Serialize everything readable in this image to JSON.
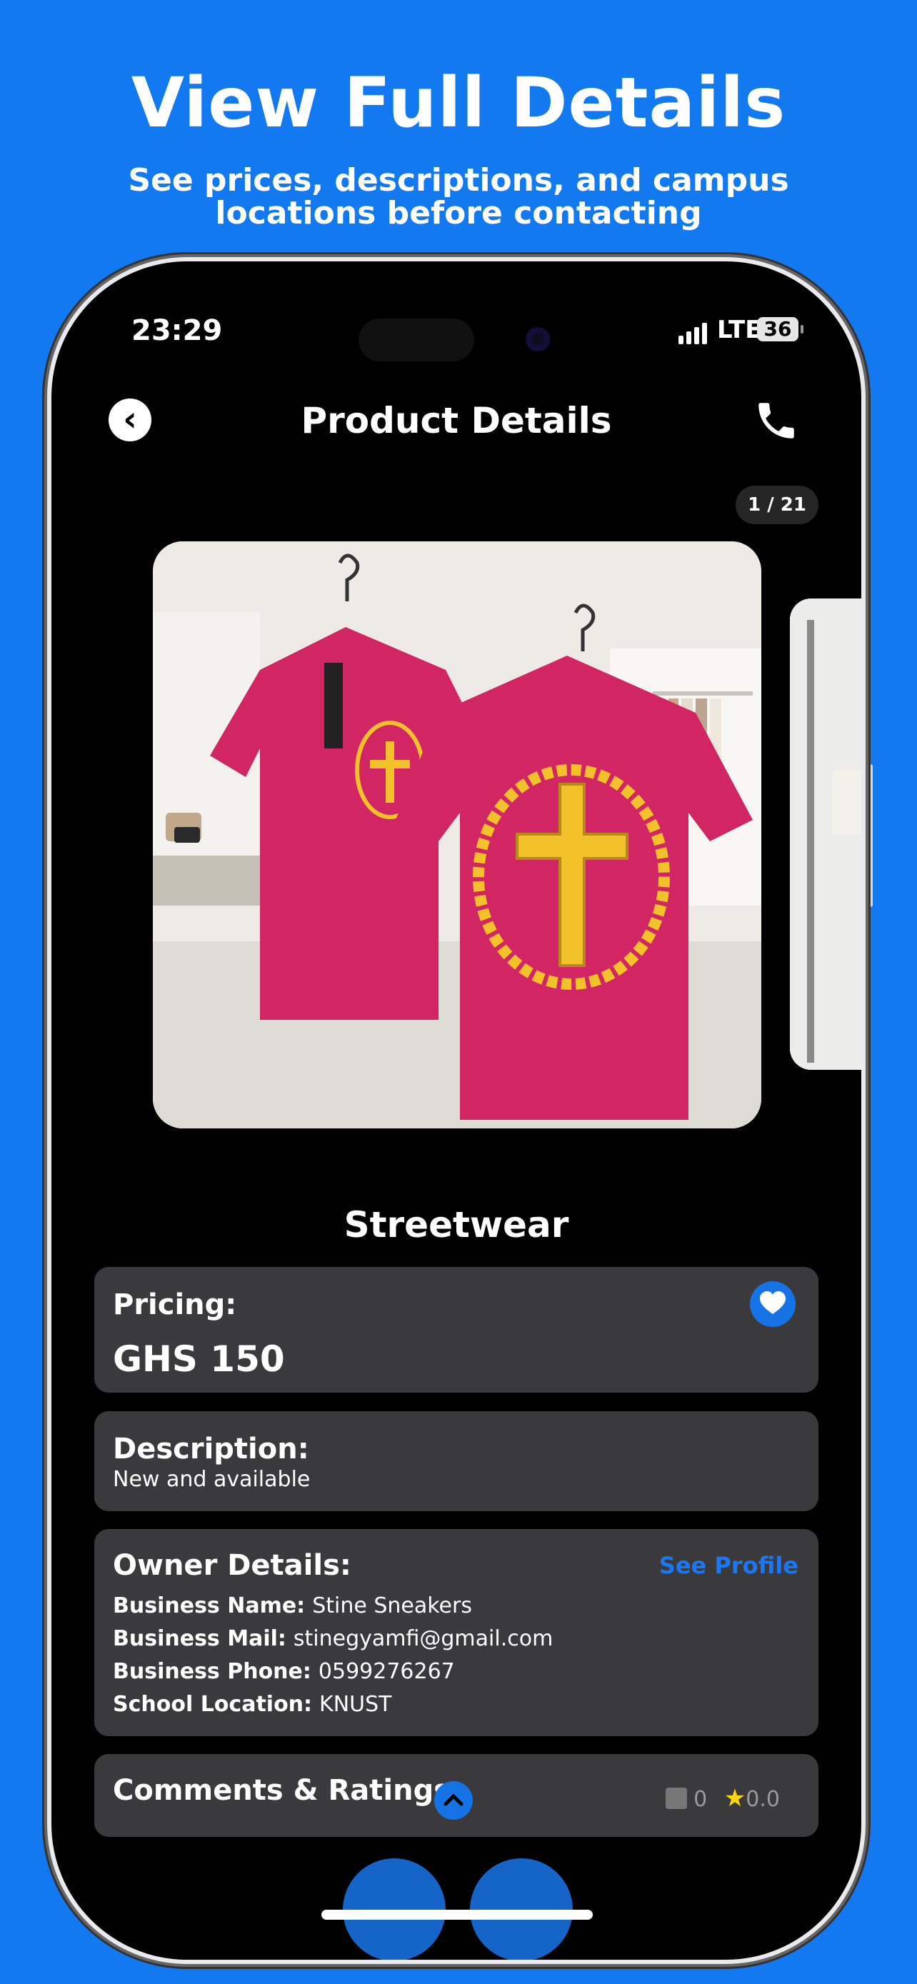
{
  "banner": {
    "title": "View Full Details",
    "subtitle": "See prices, descriptions, and campus locations before contacting"
  },
  "status_bar": {
    "time": "23:29",
    "network": "LTE",
    "battery": "36"
  },
  "nav": {
    "title": "Product Details",
    "back_icon": "chevron-left-icon",
    "call_icon": "phone-icon"
  },
  "gallery": {
    "counter": "1 / 21"
  },
  "product": {
    "name": "Streetwear",
    "pricing_label": "Pricing:",
    "price": "GHS 150",
    "description_label": "Description:",
    "description": "New and available"
  },
  "owner": {
    "label": "Owner Details:",
    "see_profile": "See Profile",
    "rows": [
      {
        "key": "Business Name:",
        "value": "Stine Sneakers"
      },
      {
        "key": "Business Mail:",
        "value": "stinegyamfi@gmail.com"
      },
      {
        "key": "Business Phone:",
        "value": "0599276267"
      },
      {
        "key": "School Location:",
        "value": "KNUST"
      }
    ]
  },
  "comments": {
    "label": "Comments & Ratings",
    "comment_count": "0",
    "rating": "0.0"
  },
  "colors": {
    "background": "#1279F0",
    "accent": "#1573E6",
    "card": "#3a3a3c",
    "star": "#FFD60A"
  }
}
